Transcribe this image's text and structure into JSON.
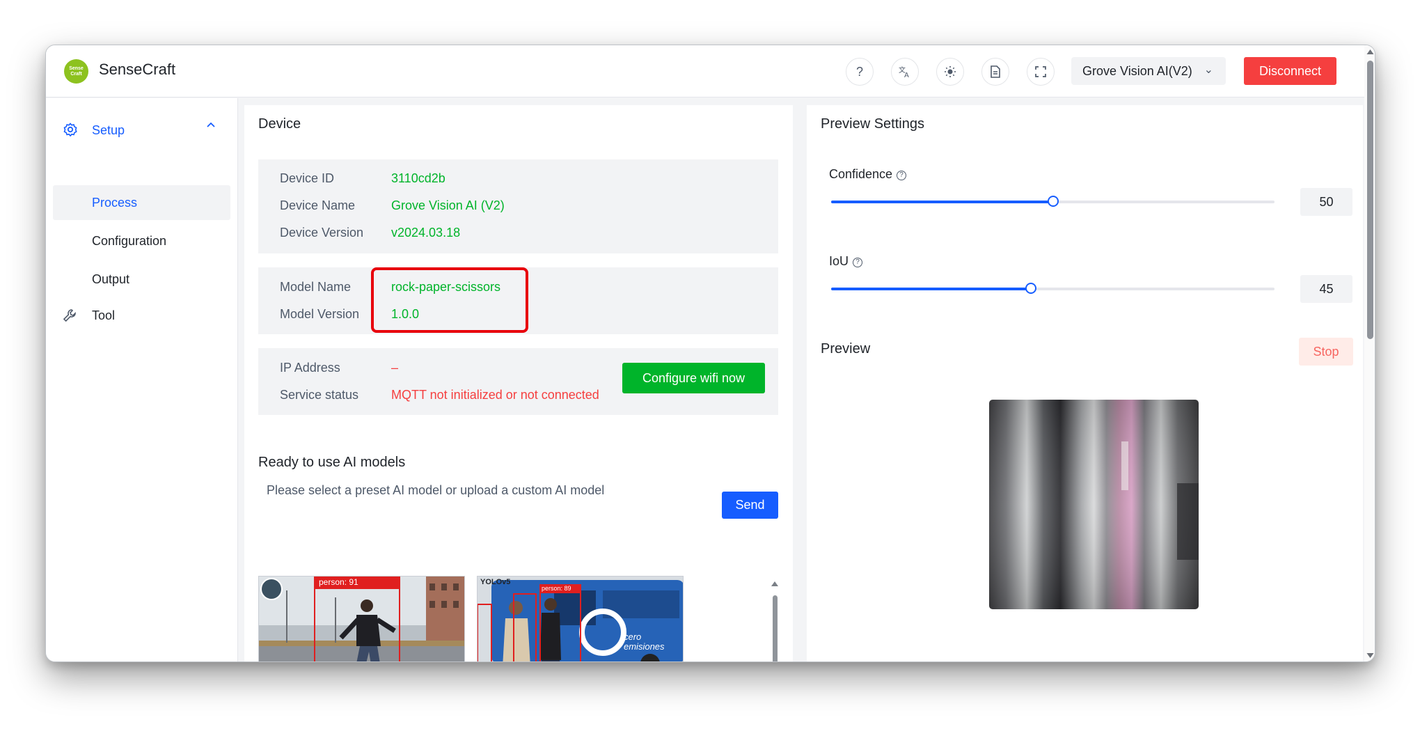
{
  "header": {
    "logo_text": "Sense Craft",
    "brand": "SenseCraft",
    "device_select": "Grove Vision AI(V2)",
    "disconnect_label": "Disconnect",
    "icons": [
      "help-icon",
      "translate-icon",
      "theme-icon",
      "document-icon",
      "fullscreen-icon"
    ]
  },
  "sidebar": {
    "setup_label": "Setup",
    "items": [
      {
        "label": "Process",
        "active": true
      },
      {
        "label": "Configuration",
        "active": false
      },
      {
        "label": "Output",
        "active": false
      }
    ],
    "tool_label": "Tool"
  },
  "device": {
    "title": "Device",
    "rows": [
      {
        "label": "Device ID",
        "value": "3110cd2b"
      },
      {
        "label": "Device Name",
        "value": "Grove Vision AI (V2)"
      },
      {
        "label": "Device Version",
        "value": "v2024.03.18"
      }
    ],
    "model_rows": [
      {
        "label": "Model Name",
        "value": "rock-paper-scissors"
      },
      {
        "label": "Model Version",
        "value": "1.0.0"
      }
    ],
    "network_rows": [
      {
        "label": "IP Address",
        "value": "–"
      },
      {
        "label": "Service status",
        "value": "MQTT not initialized or not connected"
      }
    ],
    "configure_wifi_label": "Configure wifi now"
  },
  "models": {
    "title": "Ready to use AI models",
    "subtitle": "Please select a preset AI model or upload a custom AI model",
    "send_label": "Send",
    "thumb1_tag": "person: 91",
    "thumb2_brand": "YOLOv5",
    "thumb2_tag": "person: 89",
    "thumb2_bus": "cero emisiones"
  },
  "preview_settings": {
    "title": "Preview Settings",
    "confidence_label": "Confidence",
    "confidence_value": "50",
    "confidence_fraction": 0.5,
    "iou_label": "IoU",
    "iou_value": "45",
    "iou_fraction": 0.45,
    "preview_label": "Preview",
    "stop_label": "Stop"
  },
  "colors": {
    "accent": "#165dff",
    "success": "#00b42a",
    "danger": "#f53f3f",
    "highlight": "#e8000b"
  }
}
